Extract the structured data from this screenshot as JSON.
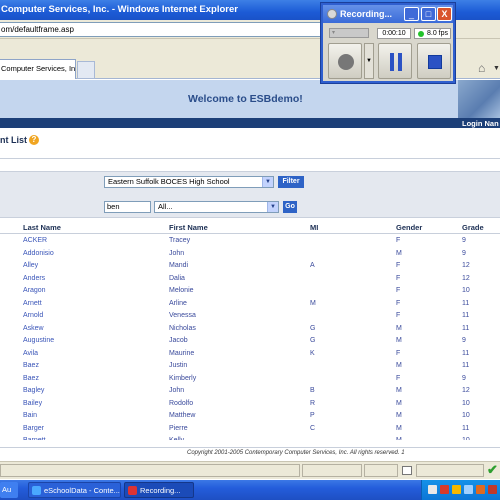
{
  "browser": {
    "title": "Computer Services, Inc. - Windows Internet Explorer",
    "url": "om/defaultframe.asp",
    "tab_label": "Computer Services, Inc."
  },
  "recorder": {
    "title": "Recording...",
    "minimize": "_",
    "maximize": "□",
    "close": "X",
    "time": "0:00:10",
    "fps": "8.0 fps"
  },
  "banner": {
    "title": "Welcome to ESBdemo!",
    "login_label": "Login Nan"
  },
  "page": {
    "heading": "nt List",
    "help": "?"
  },
  "filters": {
    "school": "Eastern Suffolk BOCES High School",
    "filter_button": "Filter",
    "search_value": "ben",
    "field": "All...",
    "go_button": "Go"
  },
  "table": {
    "headers": {
      "last": "Last Name",
      "first": "First Name",
      "mi": "MI",
      "gender": "Gender",
      "grade": "Grade"
    },
    "rows": [
      {
        "last": "ACKER",
        "first": "Tracey",
        "mi": "",
        "gender": "F",
        "grade": "9"
      },
      {
        "last": "Addonisio",
        "first": "John",
        "mi": "",
        "gender": "M",
        "grade": "9"
      },
      {
        "last": "Alley",
        "first": "Mandi",
        "mi": "A",
        "gender": "F",
        "grade": "12"
      },
      {
        "last": "Anders",
        "first": "Dalia",
        "mi": "",
        "gender": "F",
        "grade": "12"
      },
      {
        "last": "Aragon",
        "first": "Melonie",
        "mi": "",
        "gender": "F",
        "grade": "10"
      },
      {
        "last": "Arnett",
        "first": "Arline",
        "mi": "M",
        "gender": "F",
        "grade": "11"
      },
      {
        "last": "Arnold",
        "first": "Venessa",
        "mi": "",
        "gender": "F",
        "grade": "11"
      },
      {
        "last": "Askew",
        "first": "Nicholas",
        "mi": "G",
        "gender": "M",
        "grade": "11"
      },
      {
        "last": "Augustine",
        "first": "Jacob",
        "mi": "G",
        "gender": "M",
        "grade": "9"
      },
      {
        "last": "Avila",
        "first": "Maurine",
        "mi": "K",
        "gender": "F",
        "grade": "11"
      },
      {
        "last": "Baez",
        "first": "Justin",
        "mi": "",
        "gender": "M",
        "grade": "11"
      },
      {
        "last": "Baez",
        "first": "Kimberly",
        "mi": "",
        "gender": "F",
        "grade": "9"
      },
      {
        "last": "Bagley",
        "first": "John",
        "mi": "B",
        "gender": "M",
        "grade": "12"
      },
      {
        "last": "Bailey",
        "first": "Rodolfo",
        "mi": "R",
        "gender": "M",
        "grade": "10"
      },
      {
        "last": "Bain",
        "first": "Matthew",
        "mi": "P",
        "gender": "M",
        "grade": "10"
      },
      {
        "last": "Barger",
        "first": "Pierre",
        "mi": "C",
        "gender": "M",
        "grade": "11"
      },
      {
        "last": "Barnett",
        "first": "Kelly",
        "mi": "",
        "gender": "M",
        "grade": "10"
      }
    ]
  },
  "footer": {
    "copyright": "Copyright 2001-2005 Contemporary Computer Services, Inc. All rights reserved. 1"
  },
  "taskbar": {
    "item1": "Au",
    "item2": "eSchoolData - Conte...",
    "item3": "Recording..."
  },
  "colors": {
    "ie_titlebar": "#1c5bd6",
    "banner_bg": "#c4d6ee",
    "banner_title": "#2a4d8a",
    "nav_bar": "#1c3f78",
    "link": "#3a4a9c",
    "button": "#2e63c6"
  }
}
